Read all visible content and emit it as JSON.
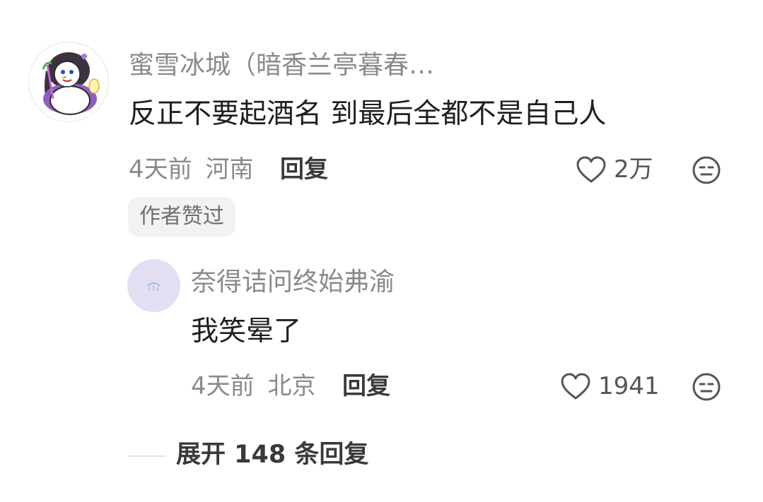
{
  "comment": {
    "username": "蜜雪冰城（暗香兰亭暮春…",
    "text": "反正不要起酒名 到最后全都不是自己人",
    "time": "4天前",
    "location": "河南",
    "reply_label": "回复",
    "like_count": "2万",
    "badge": "作者赞过",
    "avatar_icon": "snowman-avatar-icon"
  },
  "reply": {
    "username": "奈得诘问终始弗渝",
    "text": "我笑晕了",
    "time": "4天前",
    "location": "北京",
    "reply_label": "回复",
    "like_count": "1941",
    "avatar_icon": "lavender-avatar-icon"
  },
  "expand": {
    "label": "展开 148 条回复"
  },
  "colors": {
    "meta_gray": "#8a8a8a",
    "text_dark": "#1e1e1e",
    "badge_bg": "#f2f2f2",
    "reply_avatar_bg": "#e3def2"
  }
}
